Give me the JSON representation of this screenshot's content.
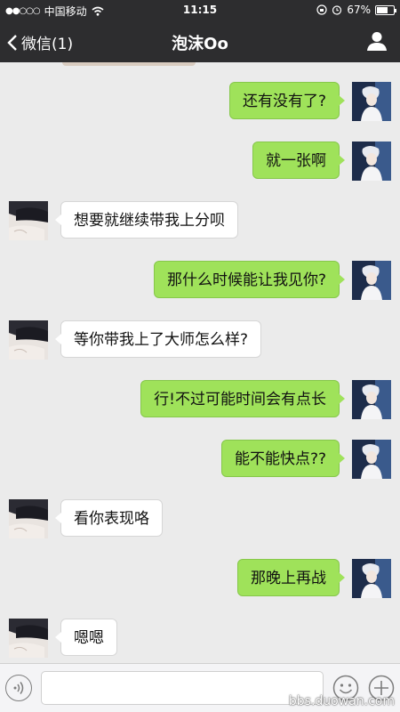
{
  "status_bar": {
    "carrier": "中国移动",
    "time": "11:15",
    "battery": "67%",
    "battery_level": 0.67
  },
  "nav": {
    "back_label": "微信(1)",
    "title": "泡沫Oo",
    "user_icon": "person-icon"
  },
  "messages": [
    {
      "side": "out",
      "text": "还有没有了?"
    },
    {
      "side": "out",
      "text": "就一张啊"
    },
    {
      "side": "in",
      "text": "想要就继续带我上分呗"
    },
    {
      "side": "out",
      "text": "那什么时候能让我见你?"
    },
    {
      "side": "in",
      "text": "等你带我上了大师怎么样?"
    },
    {
      "side": "out",
      "text": "行!不过可能时间会有点长"
    },
    {
      "side": "out",
      "text": "能不能快点??"
    },
    {
      "side": "in",
      "text": "看你表现咯"
    },
    {
      "side": "out",
      "text": "那晚上再战"
    },
    {
      "side": "in",
      "text": "嗯嗯"
    }
  ],
  "input_bar": {
    "placeholder": "",
    "voice_icon": "voice-icon",
    "emoji_icon": "emoji-icon",
    "plus_icon": "plus-icon"
  },
  "watermark": "bbs.duowan.com",
  "colors": {
    "bar": "#2d2d2f",
    "outgoing_bubble": "#9fe25a",
    "incoming_bubble": "#ffffff",
    "background": "#ebebeb"
  }
}
